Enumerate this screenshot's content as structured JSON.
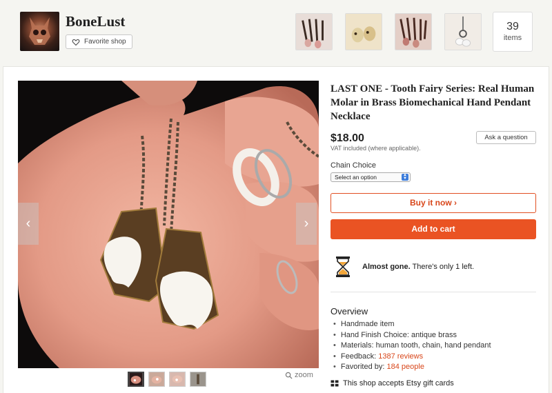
{
  "shop": {
    "name": "BoneLust",
    "favorite_label": "Favorite shop",
    "items_count": "39",
    "items_label": "items"
  },
  "listing": {
    "title": "LAST ONE - Tooth Fairy Series: Real Human Molar in Brass Biomechanical Hand Pendant Necklace",
    "price": "$18.00",
    "vat_note": "VAT included (where applicable).",
    "ask_label": "Ask a question",
    "chain_label": "Chain Choice",
    "chain_selected": "Select an option",
    "buy_label": "Buy it now ›",
    "cart_label": "Add to cart",
    "stock_bold": "Almost gone.",
    "stock_text": " There's only 1 left.",
    "zoom_label": "zoom"
  },
  "overview": {
    "heading": "Overview",
    "items": [
      {
        "text": "Handmade item",
        "link": ""
      },
      {
        "text": "Hand Finish Choice: antique brass",
        "link": ""
      },
      {
        "text": "Materials: human tooth, chain, hand pendant",
        "link": ""
      },
      {
        "text": "Feedback: ",
        "link": "1387 reviews"
      },
      {
        "text": "Favorited by: ",
        "link": "184 people"
      }
    ]
  },
  "gift_note": "This shop accepts Etsy gift cards",
  "colors": {
    "accent": "#ea5323",
    "link": "#d8461a"
  }
}
